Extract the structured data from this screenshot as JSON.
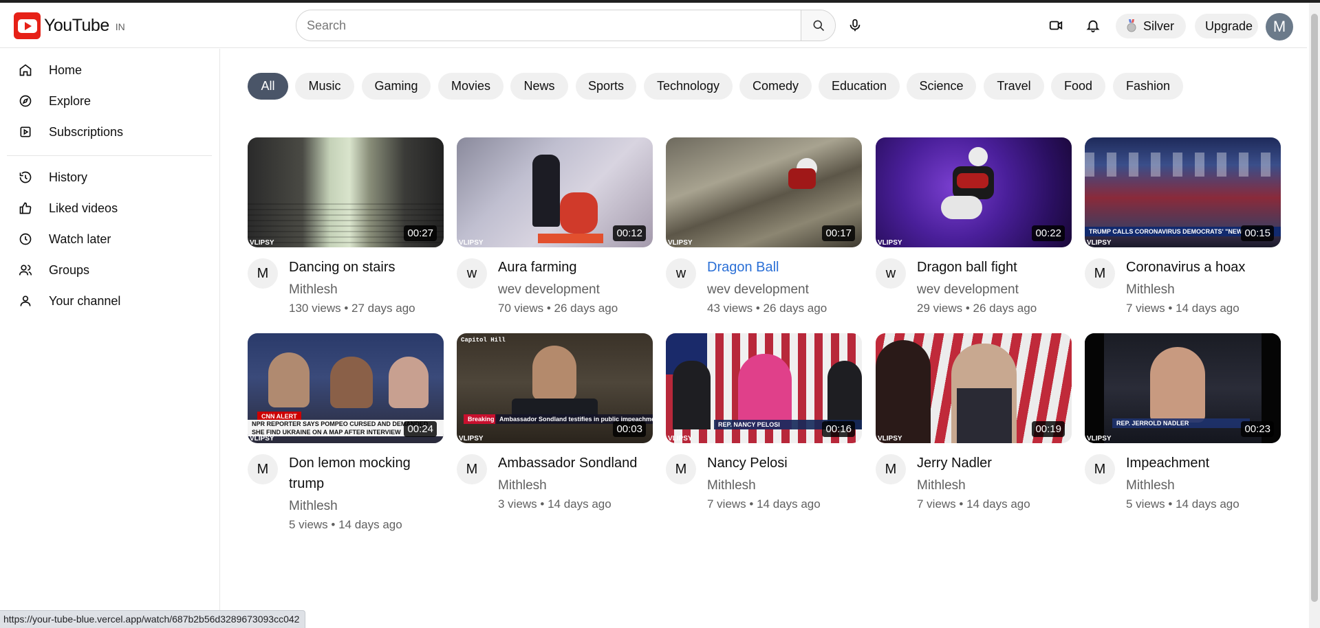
{
  "header": {
    "logo_text": "YouTube",
    "country_code": "IN",
    "search_placeholder": "Search",
    "search_value": "",
    "silver_label": "Silver",
    "upgrade_label": "Upgrade",
    "avatar_initial": "M"
  },
  "sidebar": {
    "items": [
      {
        "label": "Home",
        "icon": "home-icon"
      },
      {
        "label": "Explore",
        "icon": "compass-icon"
      },
      {
        "label": "Subscriptions",
        "icon": "subscriptions-icon"
      },
      {
        "label": "History",
        "icon": "history-icon"
      },
      {
        "label": "Liked videos",
        "icon": "thumbs-up-icon"
      },
      {
        "label": "Watch later",
        "icon": "clock-icon"
      },
      {
        "label": "Groups",
        "icon": "users-icon"
      },
      {
        "label": "Your channel",
        "icon": "user-icon"
      }
    ]
  },
  "chips": [
    "All",
    "Music",
    "Gaming",
    "Movies",
    "News",
    "Sports",
    "Technology",
    "Comedy",
    "Education",
    "Science",
    "Travel",
    "Food",
    "Fashion"
  ],
  "selected_chip": "All",
  "videos": [
    {
      "title": "Dancing on stairs",
      "channel": "Mithlesh",
      "avatar": "M",
      "stats": "130 views • 27 days ago",
      "duration": "00:27",
      "watermark": "VLIPSY"
    },
    {
      "title": "Aura farming",
      "channel": "wev development",
      "avatar": "w",
      "stats": "70 views • 26 days ago",
      "duration": "00:12",
      "watermark": "VLIPSY"
    },
    {
      "title": "Dragon Ball",
      "channel": "wev development",
      "avatar": "w",
      "stats": "43 views • 26 days ago",
      "duration": "00:17",
      "watermark": "VLIPSY"
    },
    {
      "title": "Dragon ball fight",
      "channel": "wev development",
      "avatar": "w",
      "stats": "29 views • 26 days ago",
      "duration": "00:22",
      "watermark": "VLIPSY"
    },
    {
      "title": "Coronavirus a hoax",
      "channel": "Mithlesh",
      "avatar": "M",
      "stats": "7 views • 14 days ago",
      "duration": "00:15",
      "watermark": "VLIPSY",
      "caption": "TRUMP CALLS CORONAVIRUS DEMOCRATS' \"NEW"
    },
    {
      "title": "Don lemon mocking trump",
      "channel": "Mithlesh",
      "avatar": "M",
      "stats": "5 views • 14 days ago",
      "duration": "00:24",
      "watermark": "VLIPSY",
      "caption": "NPR REPORTER SAYS POMPEO CURSED AND DEMANDED",
      "caption2": "SHE FIND UKRAINE ON A MAP AFTER INTERVIEW",
      "tag": "CNN ALERT"
    },
    {
      "title": "Ambassador Sondland",
      "channel": "Mithlesh",
      "avatar": "M",
      "stats": "3 views • 14 days ago",
      "duration": "00:03",
      "watermark": "VLIPSY",
      "caption": "Ambassador Sondland testifies in public impeachment hearing",
      "tag": "Breaking",
      "corner": "Capitol Hill"
    },
    {
      "title": "Nancy Pelosi",
      "channel": "Mithlesh",
      "avatar": "M",
      "stats": "7 views • 14 days ago",
      "duration": "00:16",
      "watermark": "VLIPSY",
      "caption": "REP. NANCY PELOSI"
    },
    {
      "title": "Jerry Nadler",
      "channel": "Mithlesh",
      "avatar": "M",
      "stats": "7 views • 14 days ago",
      "duration": "00:19",
      "watermark": "VLIPSY"
    },
    {
      "title": "Impeachment",
      "channel": "Mithlesh",
      "avatar": "M",
      "stats": "5 views • 14 days ago",
      "duration": "00:23",
      "watermark": "VLIPSY",
      "caption": "REP. JERROLD NADLER"
    }
  ],
  "status_url": "https://your-tube-blue.vercel.app/watch/687b2b56d3289673093cc042"
}
